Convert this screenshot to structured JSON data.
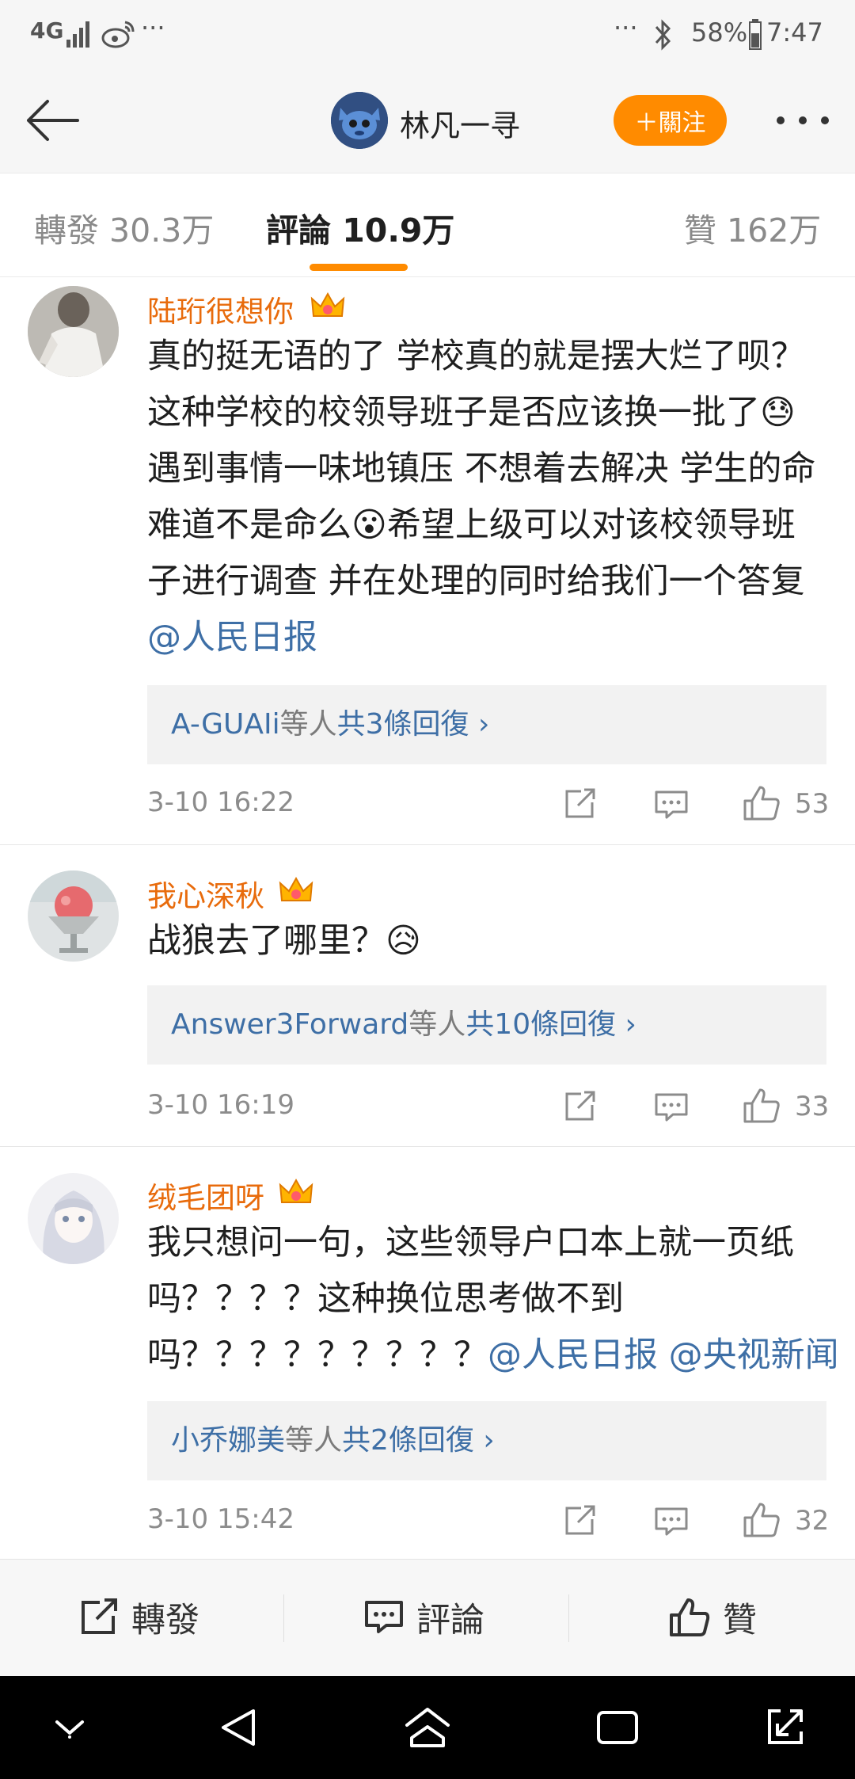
{
  "status_bar": {
    "network": "4G",
    "dots": "···",
    "dots_right": "···",
    "battery": "58%",
    "time": "7:47"
  },
  "header": {
    "title": "林凡一寻",
    "follow_label": "＋關注"
  },
  "tabs": {
    "repost": "轉發 30.3万",
    "comments": "評論 10.9万",
    "likes": "贊 162万"
  },
  "comments": [
    {
      "username": "陆珩很想你",
      "text_parts": [
        "真的挺无语的了 学校真的就是摆大烂了呗？这种学校的校领导班子是否应该换一批了😓遇到事情一味地镇压 不想着去解决 学生的命难道不是命么😮希望上级可以对该校领导班子进行调查 并在处理的同时给我们一个答复",
        "@人民日报"
      ],
      "reply_who": "A-GUAIi",
      "reply_mid": "等人",
      "reply_count": "共3條回復 ›",
      "time": "3-10 16:22",
      "likes": "53"
    },
    {
      "username": "我心深秋",
      "text_parts": [
        "战狼去了哪里？😥"
      ],
      "reply_who": "Answer3Forward",
      "reply_mid": "等人",
      "reply_count": "共10條回復 ›",
      "time": "3-10 16:19",
      "likes": "33"
    },
    {
      "username": "绒毛团呀",
      "text_parts": [
        "我只想问一句，这些领导户口本上就一页纸吗？？？？这种换位思考做不到吗？？？？？？？？？",
        "@人民日报 @央视新闻"
      ],
      "reply_who": "小乔娜美",
      "reply_mid": "等人",
      "reply_count": "共2條回復 ›",
      "time": "3-10 15:42",
      "likes": "32"
    }
  ],
  "bottom_bar": {
    "repost": "轉發",
    "comment": "評論",
    "like": "贊"
  },
  "icons": {
    "back": "back-arrow-icon",
    "more": "more-icon",
    "share": "share-icon",
    "comment": "comment-icon",
    "like": "thumbs-up-icon",
    "crown": "crown-badge-icon"
  },
  "colors": {
    "accent": "#ff8b00",
    "username": "#e86b0c",
    "link": "#3e6fa6"
  }
}
